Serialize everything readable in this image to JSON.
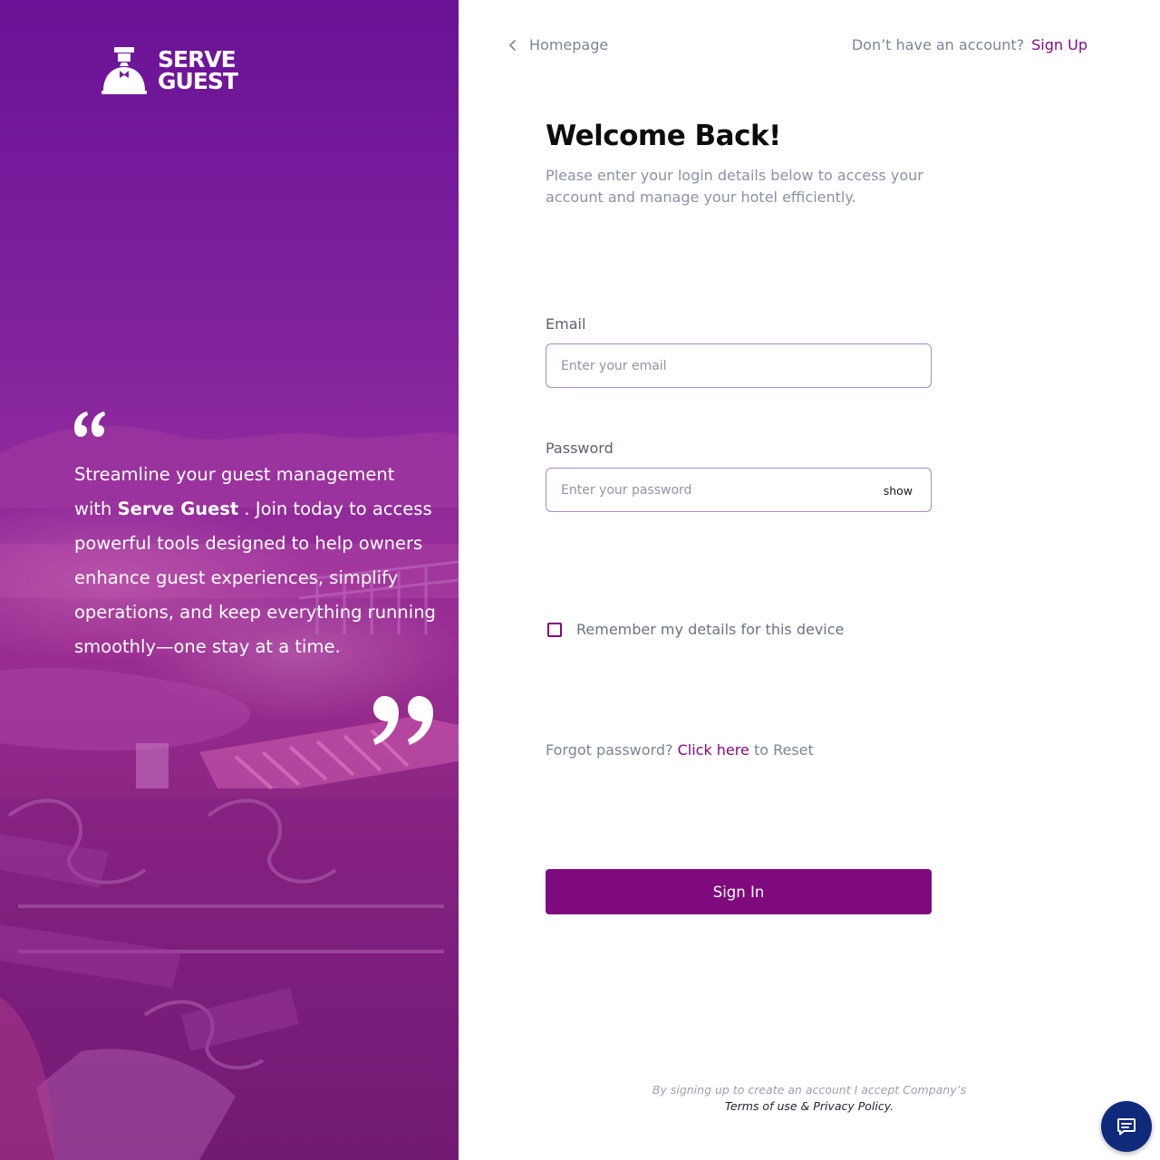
{
  "brand": {
    "logo_line1": "SERVE",
    "logo_line2": "GUEST"
  },
  "left_panel": {
    "quote_before": "Streamline your guest management with ",
    "quote_brand": "Serve Guest",
    "quote_after": " . Join today to access powerful tools designed to help owners enhance guest experiences, simplify operations, and keep everything running smoothly—one stay at a time."
  },
  "header": {
    "back_label": "Homepage",
    "signup_prompt": "Don’t have an account?",
    "signup_link": "Sign Up"
  },
  "login": {
    "title": "Welcome Back!",
    "subtitle": "Please enter your login details below to access your account and manage your hotel efficiently.",
    "email_label": "Email",
    "email_placeholder": "Enter your email",
    "password_label": "Password",
    "password_placeholder": "Enter your password",
    "show_label": "show",
    "remember_label": "Remember my details for this device",
    "forgot_prefix": "Forgot password?",
    "forgot_link": "Click here",
    "forgot_suffix": "to Reset",
    "signin_label": "Sign In"
  },
  "footer": {
    "terms_line1": "By signing up to create an account I accept Company’s",
    "terms_of_use": "Terms of use",
    "terms_amp": " & ",
    "privacy_policy": "Privacy Policy",
    "terms_end": "."
  },
  "icons": {
    "back": "chevron-left-icon",
    "chat": "chat-icon",
    "quote_open": "quote-open-icon",
    "quote_close": "quote-close-icon"
  },
  "colors": {
    "accent": "#7e0a7e",
    "panel_top": "#6a1396",
    "panel_mid": "#9a2d92",
    "chat_button": "#0f2a7a"
  }
}
